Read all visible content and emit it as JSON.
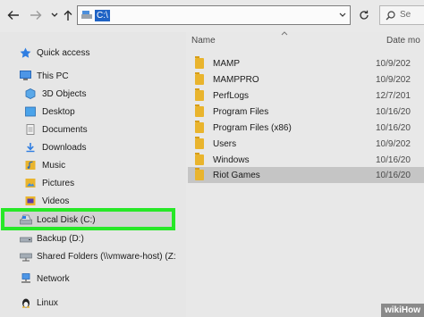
{
  "toolbar": {
    "address_path": "C:\\",
    "search_placeholder": "Se"
  },
  "nav": {
    "items": [
      {
        "label": "Quick access",
        "icon": "star-icon"
      },
      {
        "label": "This PC",
        "icon": "pc-icon"
      },
      {
        "label": "3D Objects",
        "icon": "cube-icon"
      },
      {
        "label": "Desktop",
        "icon": "desktop-icon"
      },
      {
        "label": "Documents",
        "icon": "documents-icon"
      },
      {
        "label": "Downloads",
        "icon": "downloads-icon"
      },
      {
        "label": "Music",
        "icon": "music-icon"
      },
      {
        "label": "Pictures",
        "icon": "pictures-icon"
      },
      {
        "label": "Videos",
        "icon": "videos-icon"
      },
      {
        "label": "Local Disk (C:)",
        "icon": "drive-icon"
      },
      {
        "label": "Backup (D:)",
        "icon": "drive-icon"
      },
      {
        "label": "Shared Folders (\\\\vmware-host) (Z:",
        "icon": "network-drive-icon"
      },
      {
        "label": "Network",
        "icon": "network-icon"
      },
      {
        "label": "Linux",
        "icon": "linux-icon"
      }
    ]
  },
  "content": {
    "columns": {
      "name": "Name",
      "date": "Date mo"
    },
    "rows": [
      {
        "name": "MAMP",
        "date": "10/9/202"
      },
      {
        "name": "MAMPPRO",
        "date": "10/9/202"
      },
      {
        "name": "PerfLogs",
        "date": "12/7/201"
      },
      {
        "name": "Program Files",
        "date": "10/16/20"
      },
      {
        "name": "Program Files (x86)",
        "date": "10/16/20"
      },
      {
        "name": "Users",
        "date": "10/9/202"
      },
      {
        "name": "Windows",
        "date": "10/16/20"
      },
      {
        "name": "Riot Games",
        "date": "10/16/20"
      }
    ]
  },
  "watermark": {
    "part1": "wiki",
    "part2": "How"
  }
}
